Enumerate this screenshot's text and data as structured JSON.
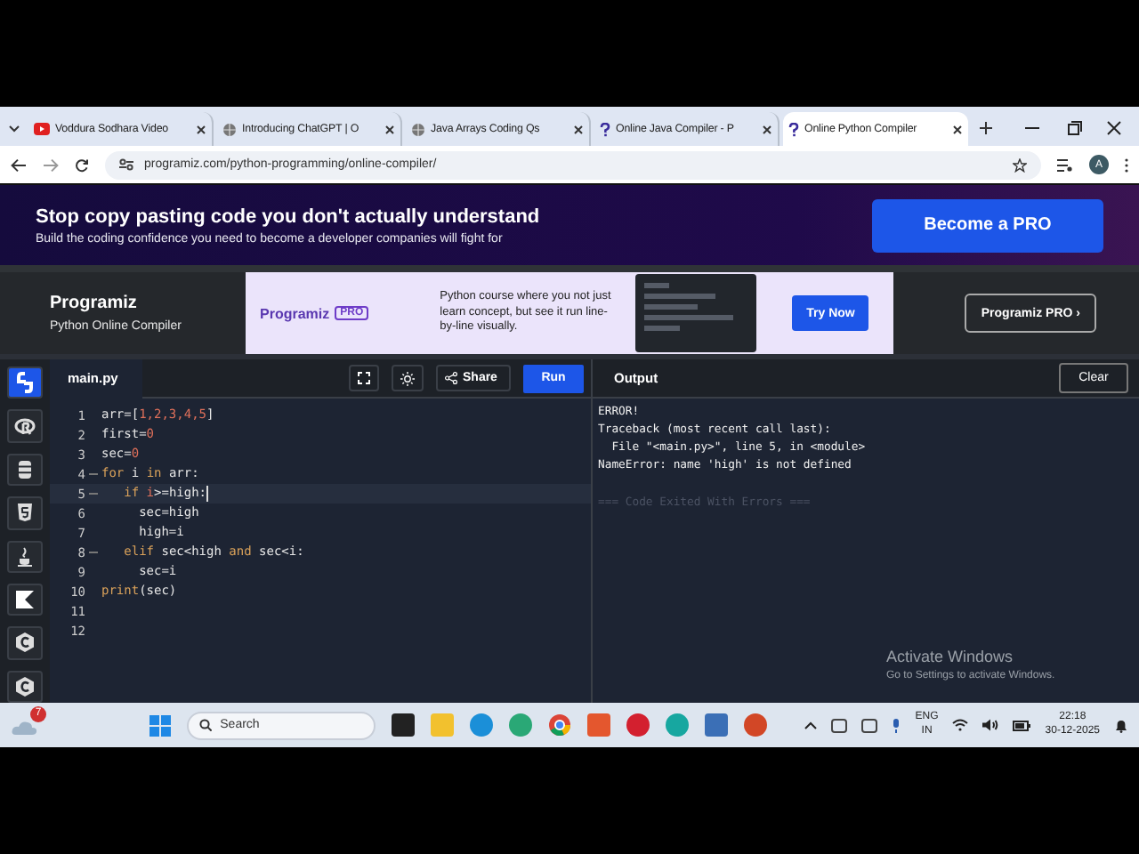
{
  "browser": {
    "tabs": [
      {
        "title": "Voddura Sodhara Video",
        "kind": "video",
        "selected": false
      },
      {
        "title": "Introducing ChatGPT | O",
        "kind": "globe",
        "selected": false
      },
      {
        "title": "Java Arrays Coding Qs",
        "kind": "globe",
        "selected": false
      },
      {
        "title": "Online Java Compiler - P",
        "kind": "programiz",
        "selected": false
      },
      {
        "title": "Online Python Compiler",
        "kind": "programiz",
        "selected": true
      }
    ],
    "url": "programiz.com/python-programming/online-compiler/",
    "profile": "A"
  },
  "promo": {
    "headline": "Stop copy pasting code you don't actually understand",
    "subline": "Build the coding confidence you need to become a developer companies will fight for",
    "button": "Become a PRO"
  },
  "header": {
    "brand": "Programiz",
    "subtitle": "Python Online Compiler",
    "ad": {
      "brand": "Programiz",
      "badge": "PRO",
      "text": "Python course where you not just learn concept, but see it run line-by-line visually.",
      "button": "Try Now"
    },
    "pro_button": "Programiz PRO ›"
  },
  "languages": [
    {
      "selected": true
    },
    {
      "selected": false
    },
    {
      "selected": false
    },
    {
      "selected": false
    },
    {
      "selected": false
    },
    {
      "selected": false
    },
    {
      "selected": false
    },
    {
      "selected": false
    }
  ],
  "editor": {
    "file": "main.py",
    "share": "Share",
    "run": "Run",
    "lines": [
      {
        "number": "1",
        "fold": false,
        "active": false,
        "tokens": [
          {
            "kind": "plain",
            "text": "arr=["
          },
          {
            "kind": "number",
            "text": "1,2,3,4,5"
          },
          {
            "kind": "plain",
            "text": "]"
          }
        ]
      },
      {
        "number": "2",
        "fold": false,
        "active": false,
        "tokens": [
          {
            "kind": "plain",
            "text": "first="
          },
          {
            "kind": "number",
            "text": "0"
          }
        ]
      },
      {
        "number": "3",
        "fold": false,
        "active": false,
        "tokens": [
          {
            "kind": "plain",
            "text": "sec="
          },
          {
            "kind": "number",
            "text": "0"
          }
        ]
      },
      {
        "number": "4",
        "fold": true,
        "active": false,
        "tokens": [
          {
            "kind": "keyword",
            "text": "for"
          },
          {
            "kind": "plain",
            "text": " i "
          },
          {
            "kind": "keyword",
            "text": "in"
          },
          {
            "kind": "plain",
            "text": " arr:"
          }
        ]
      },
      {
        "number": "5",
        "fold": true,
        "active": true,
        "tokens": [
          {
            "kind": "keyword",
            "text": "   if"
          },
          {
            "kind": "number",
            "text": " i"
          },
          {
            "kind": "plain",
            "text": ">=high:"
          }
        ]
      },
      {
        "number": "6",
        "fold": false,
        "active": false,
        "tokens": [
          {
            "kind": "plain",
            "text": "     sec=high"
          }
        ]
      },
      {
        "number": "7",
        "fold": false,
        "active": false,
        "tokens": [
          {
            "kind": "plain",
            "text": "     high=i"
          }
        ]
      },
      {
        "number": "8",
        "fold": true,
        "active": false,
        "tokens": [
          {
            "kind": "keyword",
            "text": "   elif"
          },
          {
            "kind": "plain",
            "text": " sec<high "
          },
          {
            "kind": "keyword",
            "text": "and"
          },
          {
            "kind": "plain",
            "text": " sec<i:"
          }
        ]
      },
      {
        "number": "9",
        "fold": false,
        "active": false,
        "tokens": [
          {
            "kind": "plain",
            "text": "     sec=i"
          }
        ]
      },
      {
        "number": "10",
        "fold": false,
        "active": false,
        "tokens": [
          {
            "kind": "keyword",
            "text": "print"
          },
          {
            "kind": "plain",
            "text": "(sec)"
          }
        ]
      },
      {
        "number": "11",
        "fold": false,
        "active": false
      },
      {
        "number": "12",
        "fold": false,
        "active": false
      }
    ]
  },
  "output": {
    "title": "Output",
    "clear": "Clear",
    "lines": [
      {
        "kind": "error",
        "text": "ERROR!"
      },
      {
        "kind": "error",
        "text": "Traceback (most recent call last):"
      },
      {
        "kind": "error",
        "text": "  File \"<main.py>\", line 5, in <module>"
      },
      {
        "kind": "error",
        "text": "NameError: name 'high' is not defined"
      },
      {
        "kind": "status",
        "text": "=== Code Exited With Errors ==="
      }
    ]
  },
  "activation": {
    "title": "Activate Windows",
    "hint": "Go to Settings to activate Windows."
  },
  "taskbar": {
    "badge": "7",
    "search": "Search",
    "language": "ENG",
    "region": "IN",
    "time": "22:18",
    "date": "30-12-2025"
  }
}
